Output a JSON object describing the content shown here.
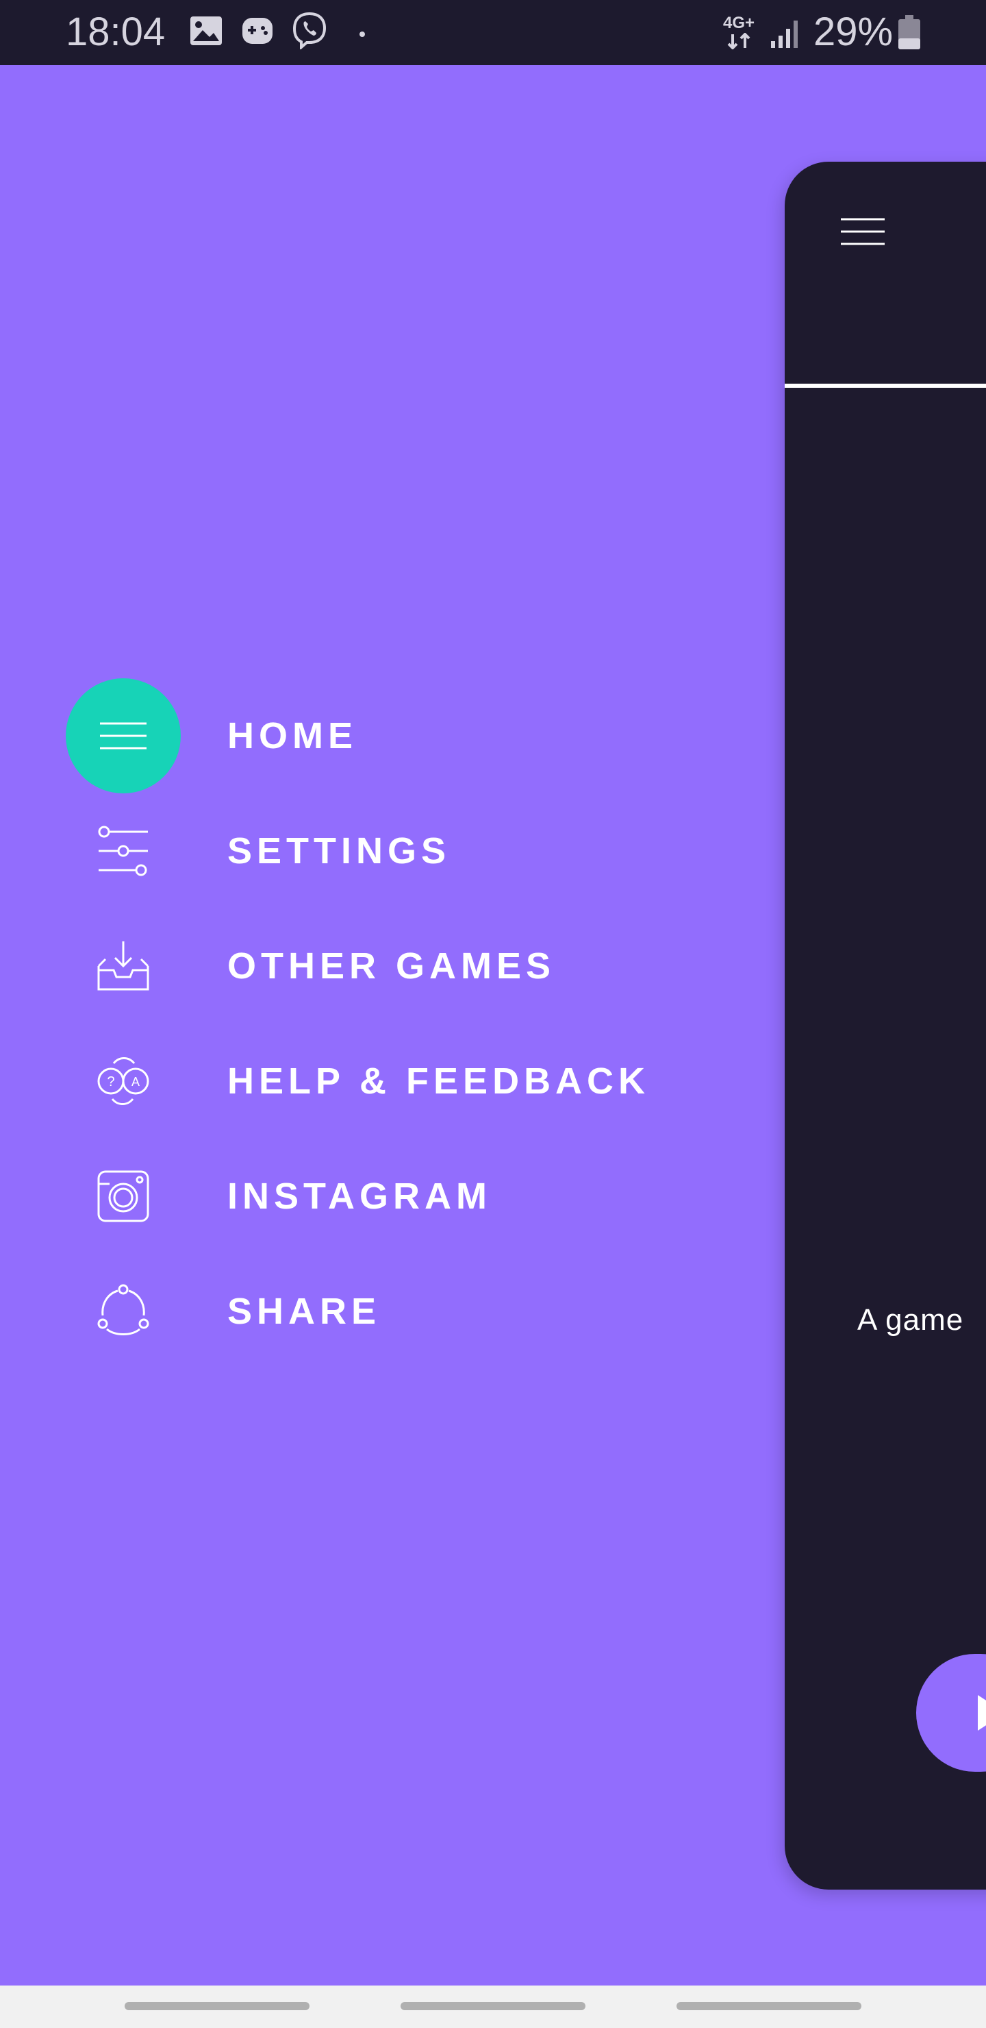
{
  "status_bar": {
    "time": "18:04",
    "network": "4G+",
    "battery": "29%",
    "icons": [
      "gallery-icon",
      "game-controller-icon",
      "viber-icon",
      "dot-icon",
      "signal-icon",
      "battery-icon"
    ]
  },
  "drawer": {
    "items": [
      {
        "label": "HOME",
        "icon": "hamburger-icon",
        "active": true
      },
      {
        "label": "SETTINGS",
        "icon": "sliders-icon",
        "active": false
      },
      {
        "label": "OTHER GAMES",
        "icon": "inbox-download-icon",
        "active": false
      },
      {
        "label": "HELP & FEEDBACK",
        "icon": "help-translate-icon",
        "active": false
      },
      {
        "label": "INSTAGRAM",
        "icon": "instagram-icon",
        "active": false
      },
      {
        "label": "SHARE",
        "icon": "share-icon",
        "active": false
      }
    ]
  },
  "app_card": {
    "tagline": "A game"
  },
  "colors": {
    "background": "#926dfd",
    "accent": "#17d3b7",
    "card": "#1e1a2e",
    "status_bar": "#1d1a2e"
  }
}
